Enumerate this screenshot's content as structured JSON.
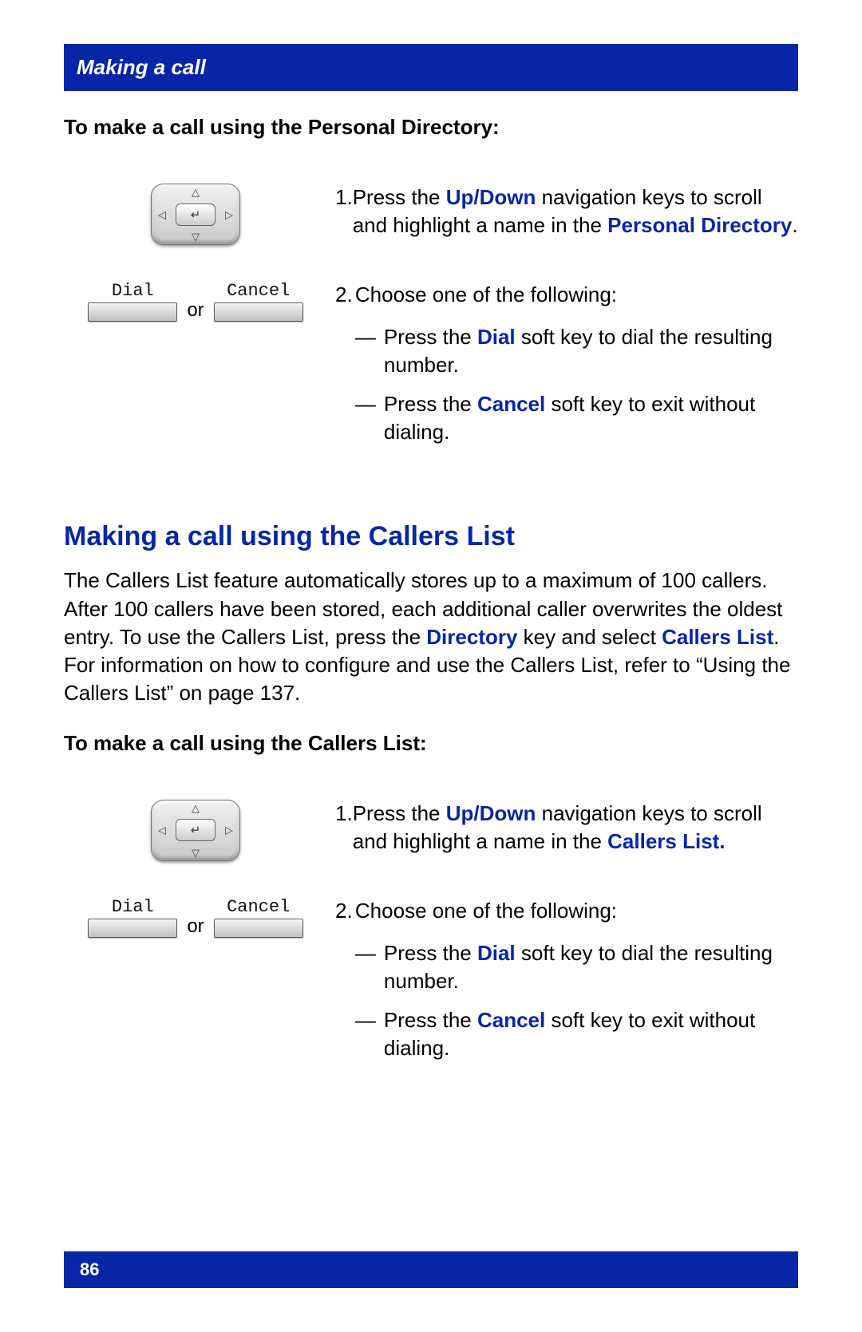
{
  "header": {
    "title": "Making a call"
  },
  "section1": {
    "subheading": "To make a call using the Personal Directory:",
    "step1": {
      "num": "1.",
      "text_a": "Press the ",
      "kw1": "Up/Down",
      "text_b": " navigation keys to scroll and highlight a name in the ",
      "kw2": "Personal Directory",
      "text_c": "."
    },
    "step2": {
      "num": "2.",
      "intro": "Choose one of the following:",
      "opt1_a": "Press the ",
      "opt1_kw": "Dial",
      "opt1_b": " soft key to dial the resulting number.",
      "opt2_a": "Press the ",
      "opt2_kw": "Cancel",
      "opt2_b": " soft key to exit without dialing."
    },
    "softkeys": {
      "dial": "Dial",
      "cancel": "Cancel",
      "or": "or"
    }
  },
  "section2": {
    "title": "Making a call using the Callers List",
    "para_a": "The Callers List feature automatically stores up to a maximum of 100 callers. After 100 callers have been stored, each additional caller overwrites the oldest entry. To use the Callers List, press the ",
    "kw1": "Directory",
    "para_b": " key and select ",
    "kw2": "Callers List",
    "para_c": ". For information on how to configure and use the Callers List, refer to “Using the Callers List” on page 137.",
    "subheading": "To make a call using the Callers List:",
    "step1": {
      "num": "1.",
      "text_a": "Press the ",
      "kw1": "Up/Down",
      "text_b": " navigation keys to scroll and highlight a name in the ",
      "kw2": "Callers List.",
      "text_c": ""
    },
    "step2": {
      "num": "2.",
      "intro": "Choose one of the following:",
      "opt1_a": "Press the ",
      "opt1_kw": "Dial",
      "opt1_b": " soft key to dial the resulting number.",
      "opt2_a": "Press the ",
      "opt2_kw": "Cancel",
      "opt2_b": " soft key to exit without dialing."
    },
    "softkeys": {
      "dial": "Dial",
      "cancel": "Cancel",
      "or": "or"
    }
  },
  "footer": {
    "page": "86"
  },
  "glyphs": {
    "dash": "—",
    "up": "△",
    "down": "▽",
    "left": "◁",
    "right": "▷",
    "enter": "↵"
  }
}
